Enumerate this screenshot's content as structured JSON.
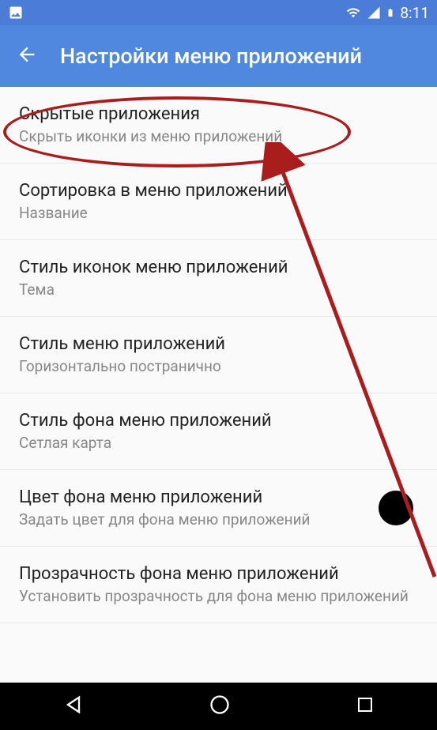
{
  "status_bar": {
    "time": "8:11"
  },
  "app_bar": {
    "title": "Настройки меню приложений"
  },
  "settings": [
    {
      "title": "Скрытые приложения",
      "subtitle": "Скрыть иконки из меню приложений"
    },
    {
      "title": "Сортировка в меню приложений",
      "subtitle": "Название"
    },
    {
      "title": "Стиль иконок меню приложений",
      "subtitle": "Тема"
    },
    {
      "title": "Стиль меню приложений",
      "subtitle": "Горизонтально постранично"
    },
    {
      "title": "Стиль фона меню приложений",
      "subtitle": "Сетлая карта"
    },
    {
      "title": "Цвет фона меню приложений",
      "subtitle": "Задать цвет для фона меню приложений",
      "has_swatch": true,
      "swatch_color": "#000000"
    },
    {
      "title": "Прозрачность фона меню приложений",
      "subtitle": "Установить прозрачность для фона меню приложений"
    }
  ]
}
